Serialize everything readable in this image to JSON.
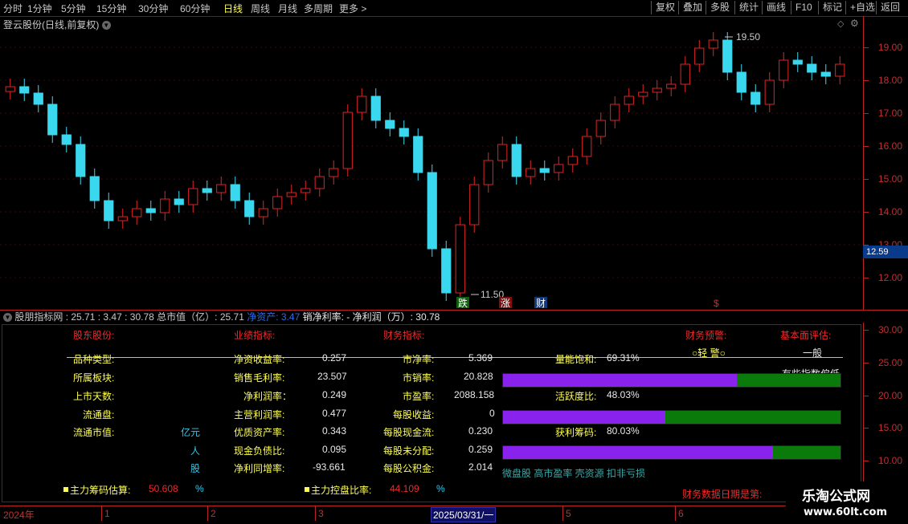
{
  "toolbar": {
    "periods": [
      "分时",
      "1分钟",
      "5分钟",
      "15分钟",
      "30分钟",
      "60分钟",
      "日线",
      "周线",
      "月线",
      "多周期",
      "更多 >"
    ],
    "active_period": "日线",
    "buttons": [
      "复权",
      "叠加",
      "多股",
      "统计",
      "画线",
      "F10",
      "标记",
      "+自选",
      "返回"
    ]
  },
  "stock_title": "登云股份(日线,前复权)",
  "price_axis": [
    "19.00",
    "18.00",
    "17.00",
    "16.00",
    "15.00",
    "14.00",
    "13.00",
    "12.00"
  ],
  "current_price": "12.59",
  "price_extremes": {
    "high": "19.50",
    "low": "11.50"
  },
  "markers": [
    {
      "text": "跌",
      "color": "#20a020"
    },
    {
      "text": "涨",
      "color": "#e02020"
    },
    {
      "text": "财",
      "color": "#2060d0"
    },
    {
      "text": "$",
      "color": "#e02020"
    }
  ],
  "indicator_header": {
    "name": "股朋指标网",
    "v1": ": 25.71",
    "v2": ": 3.47",
    "v3": ": 30.78",
    "market_cap": "总市值（亿）: 25.71",
    "net_assets": "净资产: 3.47",
    "sales_margin": "销净利率: -",
    "net_profit": "净利润（万）: 30.78"
  },
  "panel": {
    "headers": {
      "company": "股东股份:",
      "performance": "业绩指标:",
      "financial": "财务指标:",
      "warning": "财务预警:",
      "fundamental": "基本面评估:"
    },
    "warning_value": "○轻 警○",
    "fundamental_value": "一般",
    "fundamental_note": "有些指数偏低",
    "left_labels": [
      "品种类型:",
      "所属板块:",
      "上市天数:",
      "流通盘:",
      "流通市值:"
    ],
    "units": [
      "亿元",
      "人",
      "股"
    ],
    "perf": [
      {
        "label": "净资收益率:",
        "value": "0.257"
      },
      {
        "label": "销售毛利率:",
        "value": "23.507"
      },
      {
        "label": "净利润率：",
        "value": "0.249"
      },
      {
        "label": "主营利润率:",
        "value": "0.477"
      },
      {
        "label": "优质资产率:",
        "value": "0.343"
      },
      {
        "label": "现金负债比:",
        "value": "0.095"
      },
      {
        "label": "净利同增率:",
        "value": "-93.661"
      }
    ],
    "fin": [
      {
        "label": "市净率:",
        "value": "5.369"
      },
      {
        "label": "市销率:",
        "value": "20.828"
      },
      {
        "label": "市盈率:",
        "value": "2088.158"
      },
      {
        "label": "每股收益:",
        "value": "0"
      },
      {
        "label": "每股现金流:",
        "value": "0.230"
      },
      {
        "label": "每股未分配:",
        "value": "0.259"
      },
      {
        "label": "每股公积金:",
        "value": "2.014"
      }
    ],
    "bars": [
      {
        "label": "量能饱和:",
        "value": "69.31%",
        "fraction": 0.6931
      },
      {
        "label": "活跃度比:",
        "value": "48.03%",
        "fraction": 0.4803
      },
      {
        "label": "获利筹码:",
        "value": "80.03%",
        "fraction": 0.8003
      }
    ],
    "tags": "微盘股 高市盈率 壳资源 扣非亏损",
    "chip_est_label": "主力筹码估算:",
    "chip_est_value": "50.608",
    "control_label": "主力控盘比率:",
    "control_value": "44.109",
    "percent": "%",
    "date_note": "财务数据日期是第:"
  },
  "lower_axis": [
    "30.00",
    "25.00",
    "20.00",
    "15.00",
    "10.00"
  ],
  "date_axis": [
    "2024年",
    "1",
    "2",
    "3",
    "2025/03/31/一",
    "5",
    "6"
  ],
  "colors": {
    "up": "#e02424",
    "down": "#3ad8ee",
    "axis": "#b22222",
    "highlight": "#ffff55"
  }
}
